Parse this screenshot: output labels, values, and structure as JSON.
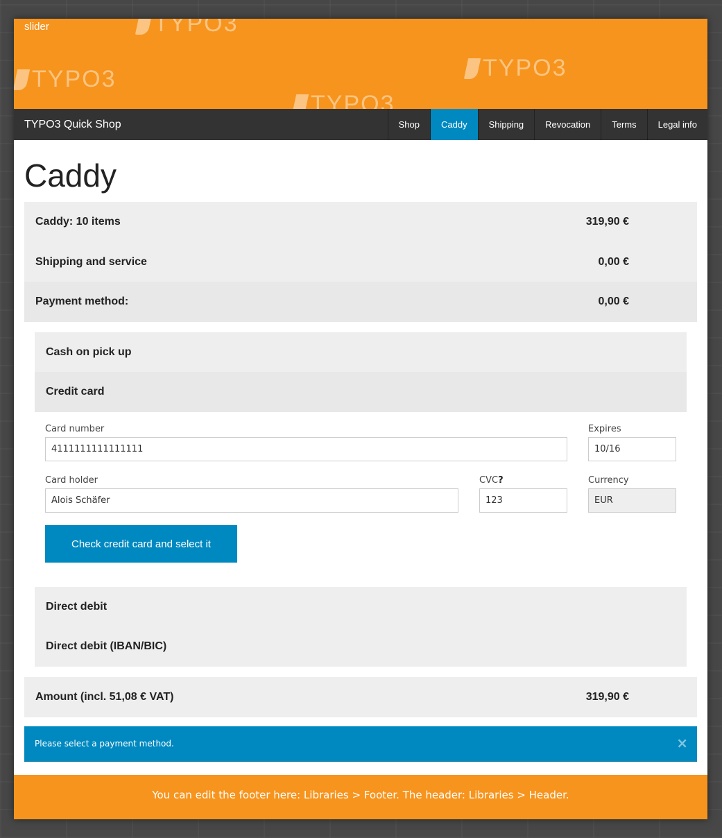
{
  "slider": {
    "label": "slider",
    "watermark": "TYPO3"
  },
  "nav": {
    "brand": "TYPO3 Quick Shop",
    "items": [
      {
        "label": "Shop"
      },
      {
        "label": "Caddy"
      },
      {
        "label": "Shipping"
      },
      {
        "label": "Revocation"
      },
      {
        "label": "Terms"
      },
      {
        "label": "Legal info"
      }
    ],
    "active": "Caddy"
  },
  "page_title": "Caddy",
  "summary": {
    "caddy": {
      "label": "Caddy: 10 items",
      "value": "319,90 €"
    },
    "shipping": {
      "label": "Shipping and service",
      "value": "0,00 €"
    },
    "payment": {
      "label": "Payment method:",
      "value": "0,00 €"
    }
  },
  "payment_methods": {
    "cash": "Cash on pick up",
    "credit_card": "Credit card",
    "direct_debit": "Direct debit",
    "direct_debit_iban": "Direct debit (IBAN/BIC)"
  },
  "credit_card_form": {
    "card_number_label": "Card number",
    "card_number_value": "4111111111111111",
    "expires_label": "Expires",
    "expires_value": "10/16",
    "holder_label": "Card holder",
    "holder_value": "Alois Schäfer",
    "cvc_label": "CVC",
    "cvc_help": "?",
    "cvc_value": "123",
    "currency_label": "Currency",
    "currency_value": "EUR",
    "submit_label": "Check credit card and select it"
  },
  "amount": {
    "label": "Amount (incl. 51,08 € VAT)",
    "value": "319,90 €"
  },
  "alert": {
    "message": "Please select a payment method.",
    "close": "×"
  },
  "footer": {
    "text": "You can edit the footer here: Libraries > Footer. The header: Libraries > Header."
  },
  "colors": {
    "accent": "#f7941d",
    "primary": "#0089c0",
    "navbar": "#333333"
  }
}
